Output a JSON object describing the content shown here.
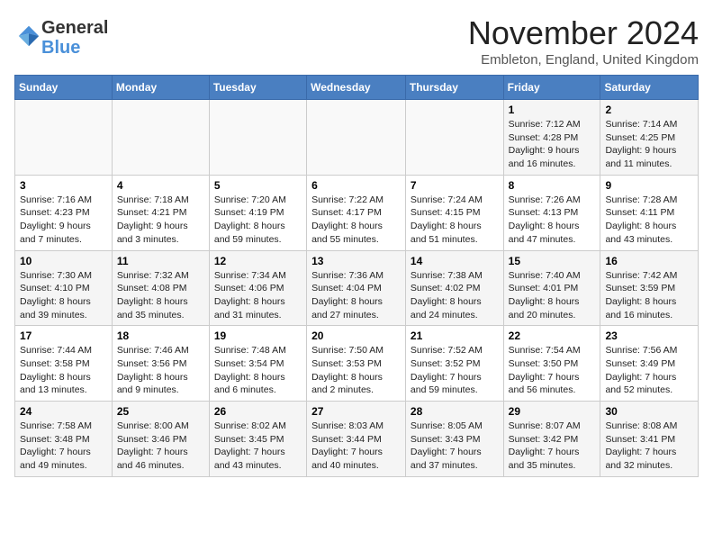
{
  "header": {
    "logo_general": "General",
    "logo_blue": "Blue",
    "month_title": "November 2024",
    "location": "Embleton, England, United Kingdom"
  },
  "weekdays": [
    "Sunday",
    "Monday",
    "Tuesday",
    "Wednesday",
    "Thursday",
    "Friday",
    "Saturday"
  ],
  "weeks": [
    [
      {
        "day": "",
        "info": ""
      },
      {
        "day": "",
        "info": ""
      },
      {
        "day": "",
        "info": ""
      },
      {
        "day": "",
        "info": ""
      },
      {
        "day": "",
        "info": ""
      },
      {
        "day": "1",
        "info": "Sunrise: 7:12 AM\nSunset: 4:28 PM\nDaylight: 9 hours and 16 minutes."
      },
      {
        "day": "2",
        "info": "Sunrise: 7:14 AM\nSunset: 4:25 PM\nDaylight: 9 hours and 11 minutes."
      }
    ],
    [
      {
        "day": "3",
        "info": "Sunrise: 7:16 AM\nSunset: 4:23 PM\nDaylight: 9 hours and 7 minutes."
      },
      {
        "day": "4",
        "info": "Sunrise: 7:18 AM\nSunset: 4:21 PM\nDaylight: 9 hours and 3 minutes."
      },
      {
        "day": "5",
        "info": "Sunrise: 7:20 AM\nSunset: 4:19 PM\nDaylight: 8 hours and 59 minutes."
      },
      {
        "day": "6",
        "info": "Sunrise: 7:22 AM\nSunset: 4:17 PM\nDaylight: 8 hours and 55 minutes."
      },
      {
        "day": "7",
        "info": "Sunrise: 7:24 AM\nSunset: 4:15 PM\nDaylight: 8 hours and 51 minutes."
      },
      {
        "day": "8",
        "info": "Sunrise: 7:26 AM\nSunset: 4:13 PM\nDaylight: 8 hours and 47 minutes."
      },
      {
        "day": "9",
        "info": "Sunrise: 7:28 AM\nSunset: 4:11 PM\nDaylight: 8 hours and 43 minutes."
      }
    ],
    [
      {
        "day": "10",
        "info": "Sunrise: 7:30 AM\nSunset: 4:10 PM\nDaylight: 8 hours and 39 minutes."
      },
      {
        "day": "11",
        "info": "Sunrise: 7:32 AM\nSunset: 4:08 PM\nDaylight: 8 hours and 35 minutes."
      },
      {
        "day": "12",
        "info": "Sunrise: 7:34 AM\nSunset: 4:06 PM\nDaylight: 8 hours and 31 minutes."
      },
      {
        "day": "13",
        "info": "Sunrise: 7:36 AM\nSunset: 4:04 PM\nDaylight: 8 hours and 27 minutes."
      },
      {
        "day": "14",
        "info": "Sunrise: 7:38 AM\nSunset: 4:02 PM\nDaylight: 8 hours and 24 minutes."
      },
      {
        "day": "15",
        "info": "Sunrise: 7:40 AM\nSunset: 4:01 PM\nDaylight: 8 hours and 20 minutes."
      },
      {
        "day": "16",
        "info": "Sunrise: 7:42 AM\nSunset: 3:59 PM\nDaylight: 8 hours and 16 minutes."
      }
    ],
    [
      {
        "day": "17",
        "info": "Sunrise: 7:44 AM\nSunset: 3:58 PM\nDaylight: 8 hours and 13 minutes."
      },
      {
        "day": "18",
        "info": "Sunrise: 7:46 AM\nSunset: 3:56 PM\nDaylight: 8 hours and 9 minutes."
      },
      {
        "day": "19",
        "info": "Sunrise: 7:48 AM\nSunset: 3:54 PM\nDaylight: 8 hours and 6 minutes."
      },
      {
        "day": "20",
        "info": "Sunrise: 7:50 AM\nSunset: 3:53 PM\nDaylight: 8 hours and 2 minutes."
      },
      {
        "day": "21",
        "info": "Sunrise: 7:52 AM\nSunset: 3:52 PM\nDaylight: 7 hours and 59 minutes."
      },
      {
        "day": "22",
        "info": "Sunrise: 7:54 AM\nSunset: 3:50 PM\nDaylight: 7 hours and 56 minutes."
      },
      {
        "day": "23",
        "info": "Sunrise: 7:56 AM\nSunset: 3:49 PM\nDaylight: 7 hours and 52 minutes."
      }
    ],
    [
      {
        "day": "24",
        "info": "Sunrise: 7:58 AM\nSunset: 3:48 PM\nDaylight: 7 hours and 49 minutes."
      },
      {
        "day": "25",
        "info": "Sunrise: 8:00 AM\nSunset: 3:46 PM\nDaylight: 7 hours and 46 minutes."
      },
      {
        "day": "26",
        "info": "Sunrise: 8:02 AM\nSunset: 3:45 PM\nDaylight: 7 hours and 43 minutes."
      },
      {
        "day": "27",
        "info": "Sunrise: 8:03 AM\nSunset: 3:44 PM\nDaylight: 7 hours and 40 minutes."
      },
      {
        "day": "28",
        "info": "Sunrise: 8:05 AM\nSunset: 3:43 PM\nDaylight: 7 hours and 37 minutes."
      },
      {
        "day": "29",
        "info": "Sunrise: 8:07 AM\nSunset: 3:42 PM\nDaylight: 7 hours and 35 minutes."
      },
      {
        "day": "30",
        "info": "Sunrise: 8:08 AM\nSunset: 3:41 PM\nDaylight: 7 hours and 32 minutes."
      }
    ]
  ]
}
